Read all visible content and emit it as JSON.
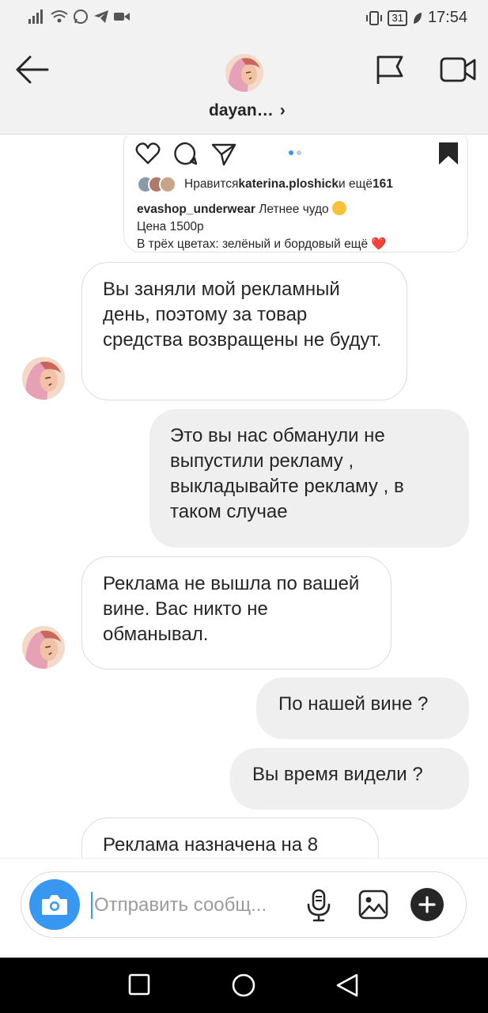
{
  "status_bar": {
    "battery": "31",
    "time": "17:54"
  },
  "header": {
    "username": "dayan…",
    "chevron": "›"
  },
  "post": {
    "likes_prefix": "Нравится ",
    "likes_user": "katerina.ploshick",
    "likes_mid": " и ещё ",
    "likes_count": "161",
    "caption_user": "evashop_underwear",
    "caption_text": " Летнее чудо",
    "price_line": "Цена 1500р",
    "truncated_line": "В трёх цветах: зелёный и бордовый ещё ❤️"
  },
  "messages": [
    {
      "side": "in",
      "text": "Вы заняли мой рекламный день, поэтому за товар средства возвращены не будут."
    },
    {
      "side": "out",
      "text": "Это вы нас обманули не выпустили рекламу , выкладывайте рекламу , в таком случае"
    },
    {
      "side": "in",
      "text": "Реклама не вышла по вашей вине. Вас никто не обманывал."
    },
    {
      "side": "out",
      "text": "По нашей вине ?"
    },
    {
      "side": "out",
      "text": "Вы время видели ?"
    },
    {
      "side": "in",
      "text": "Реклама назначена на 8"
    }
  ],
  "composer": {
    "placeholder": "Отправить сообщ..."
  },
  "icons": {
    "back": "arrow-left-icon",
    "flag": "flag-icon",
    "video": "video-camera-icon",
    "like": "heart-icon",
    "comment": "comment-icon",
    "share": "paper-plane-icon",
    "save": "bookmark-icon",
    "camera": "camera-icon",
    "mic": "microphone-icon",
    "gallery": "image-icon",
    "plus": "plus-icon",
    "nav_recent": "square-icon",
    "nav_home": "circle-icon",
    "nav_back": "triangle-back-icon"
  },
  "colors": {
    "accent": "#3897f0",
    "incoming_bubble": "#ffffff",
    "outgoing_bubble": "#efefef",
    "heart": "#ed4956"
  }
}
